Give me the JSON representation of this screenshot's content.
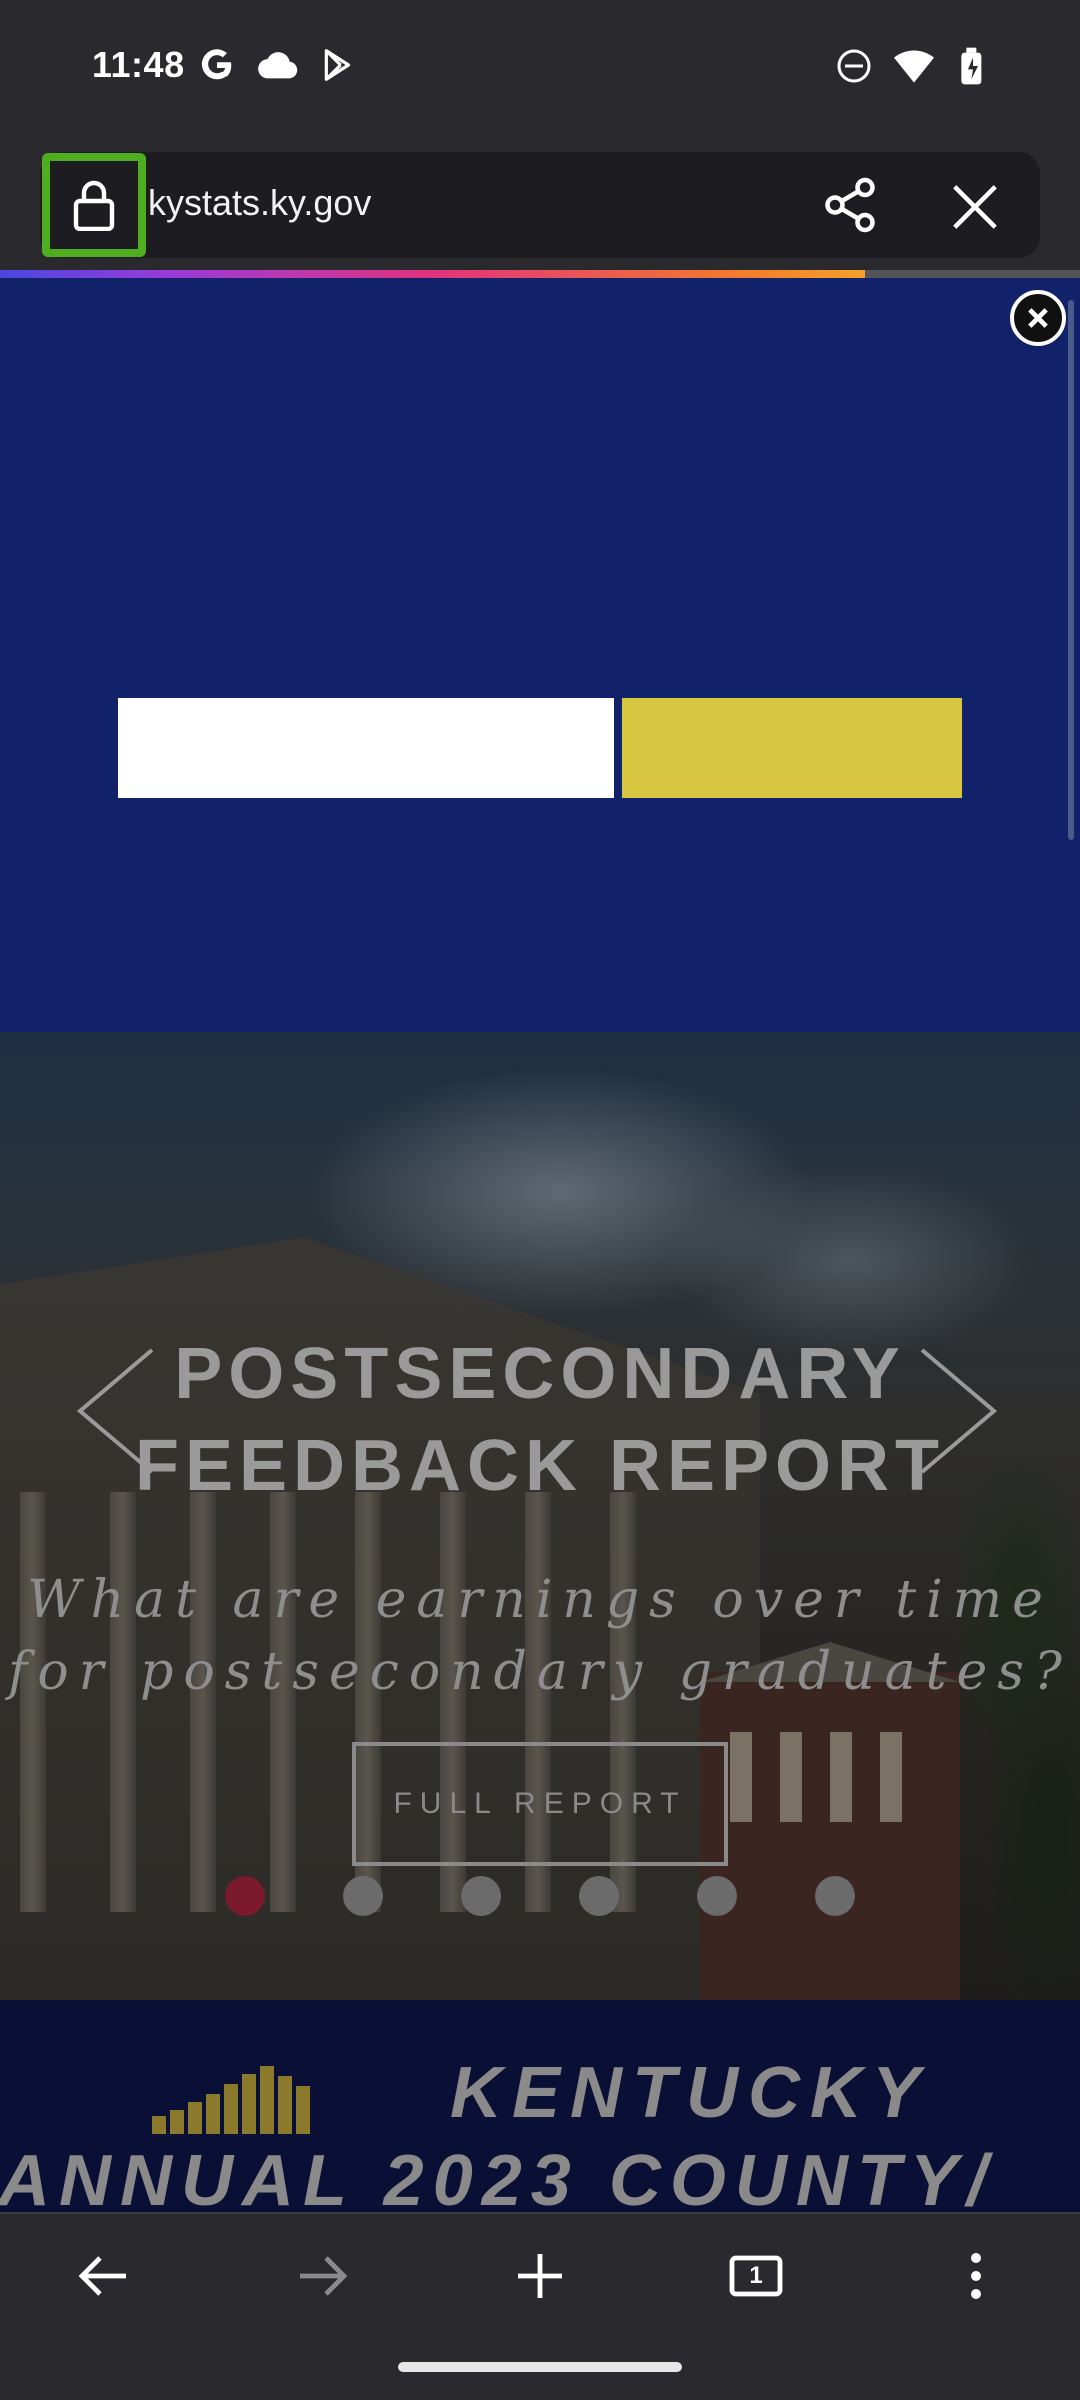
{
  "status_bar": {
    "time": "11:48",
    "left_icons": [
      "google-icon",
      "cloud-icon",
      "play-store-icon"
    ],
    "right_icons": [
      "dnd-icon",
      "wifi-icon",
      "battery-charging-icon"
    ]
  },
  "browser": {
    "url": "kystats.ky.gov",
    "lock_highlight_color": "#4fae1f",
    "page_load_progress": 0.8
  },
  "modal": {
    "background": "#11226a",
    "close_icon": "close-circle-icon"
  },
  "hero": {
    "title_line1": "POSTSECONDARY",
    "title_line2": "FEEDBACK REPORT",
    "subtitle_line1": "What are earnings over time",
    "subtitle_line2": "for postsecondary graduates?",
    "button_label": "FULL REPORT",
    "slide_count": 6,
    "active_slide": 1
  },
  "banner": {
    "line1": "KENTUCKY",
    "line2": "ANNUAL 2023 COUNTY/"
  },
  "toolbar": {
    "tab_count": "1",
    "icons": [
      "back-arrow-icon",
      "forward-arrow-icon",
      "new-tab-icon",
      "tab-switcher-icon",
      "more-menu-icon"
    ]
  }
}
